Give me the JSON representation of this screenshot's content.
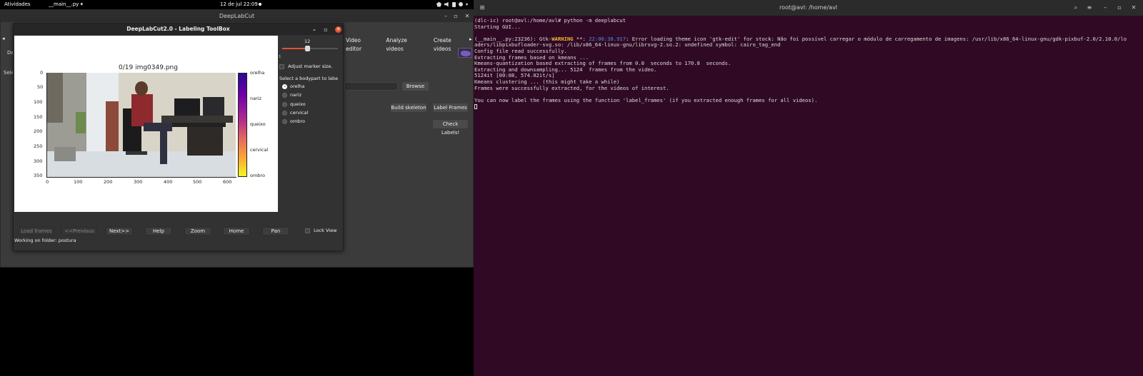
{
  "topbar": {
    "activities": "Atividades",
    "app_menu": "__main__.py ▾",
    "clock": "12 de jul  22:09"
  },
  "dlc_window": {
    "title": "DeepLabCut",
    "tabs": [
      "Video editor",
      "Analyze videos",
      "Create videos"
    ],
    "frag_de": "De",
    "frag_sele": "Sele",
    "browse_label": "Browse",
    "build_skeleton_label": "Build skeleton",
    "label_frames_label": "Label Frames",
    "check_labels_label": "Check Labels!"
  },
  "labeling_toolbox": {
    "title": "DeepLabCut2.0 - Labeling ToolBox",
    "plot_title": "0/19 img0349.png",
    "x_ticks": [
      "0",
      "100",
      "200",
      "300",
      "400",
      "500",
      "600"
    ],
    "y_ticks": [
      "0",
      "50",
      "100",
      "150",
      "200",
      "250",
      "300",
      "350"
    ],
    "colorbar_labels": [
      "orelha",
      "nariz",
      "queixo",
      "cervical",
      "ombro"
    ],
    "marker_slider_value": "12",
    "marker_slider_min": "1",
    "adjust_marker_label": "Adjust marker size.",
    "bodypart_prompt": "Select a bodypart to labe",
    "bodyparts": [
      "orelha",
      "nariz",
      "queixo",
      "cervical",
      "ombro"
    ],
    "selected_bodypart": "orelha",
    "buttons": {
      "load_frames": "Load frames",
      "previous": "<<Previous",
      "next": "Next>>",
      "help": "Help",
      "zoom": "Zoom",
      "home": "Home",
      "pan": "Pan"
    },
    "lock_view_label": "Lock View",
    "status": "Working on folder: postura"
  },
  "terminal": {
    "title": "root@avl: /home/avl",
    "lines": [
      {
        "t": "(dlc-ic) root@avl:/home/avl# python -m deeplabcut"
      },
      {
        "t": "Starting GUI..."
      },
      {
        "t": ""
      },
      {
        "pre": "(__main__.py:23236): Gtk-",
        "warn": "WARNING",
        "mid": " **: ",
        "ts": "22:06:38.917",
        "post": ": Error loading theme icon 'gtk-edit' for stock: Não foi possível carregar o módulo de carregamento de imagens: /usr/lib/x86_64-linux-gnu/gdk-pixbuf-2.0/2.10.0/lo"
      },
      {
        "t": "aders/libpixbufloader-svg.so: /lib/x86_64-linux-gnu/librsvg-2.so.2: undefined symbol: cairo_tag_end"
      },
      {
        "t": "Config file read successfully."
      },
      {
        "t": "Extracting frames based on kmeans ..."
      },
      {
        "t": "Kmeans-quantization based extracting of frames from 0.0  seconds to 170.8  seconds."
      },
      {
        "t": "Extracting and downsampling... 5124  frames from the video."
      },
      {
        "t": "5124it [00:08, 574.02it/s]"
      },
      {
        "t": "Kmeans clustering ... (this might take a while)"
      },
      {
        "t": "Frames were successfully extracted, for the videos of interest."
      },
      {
        "t": ""
      },
      {
        "t": "You can now label the frames using the function 'label_frames' (if you extracted enough frames for all videos)."
      }
    ]
  },
  "colors": {
    "terminal_bg": "#300a24",
    "warning": "#f3b434",
    "timestamp": "#4c8de0",
    "close_button": "#e0532f"
  }
}
